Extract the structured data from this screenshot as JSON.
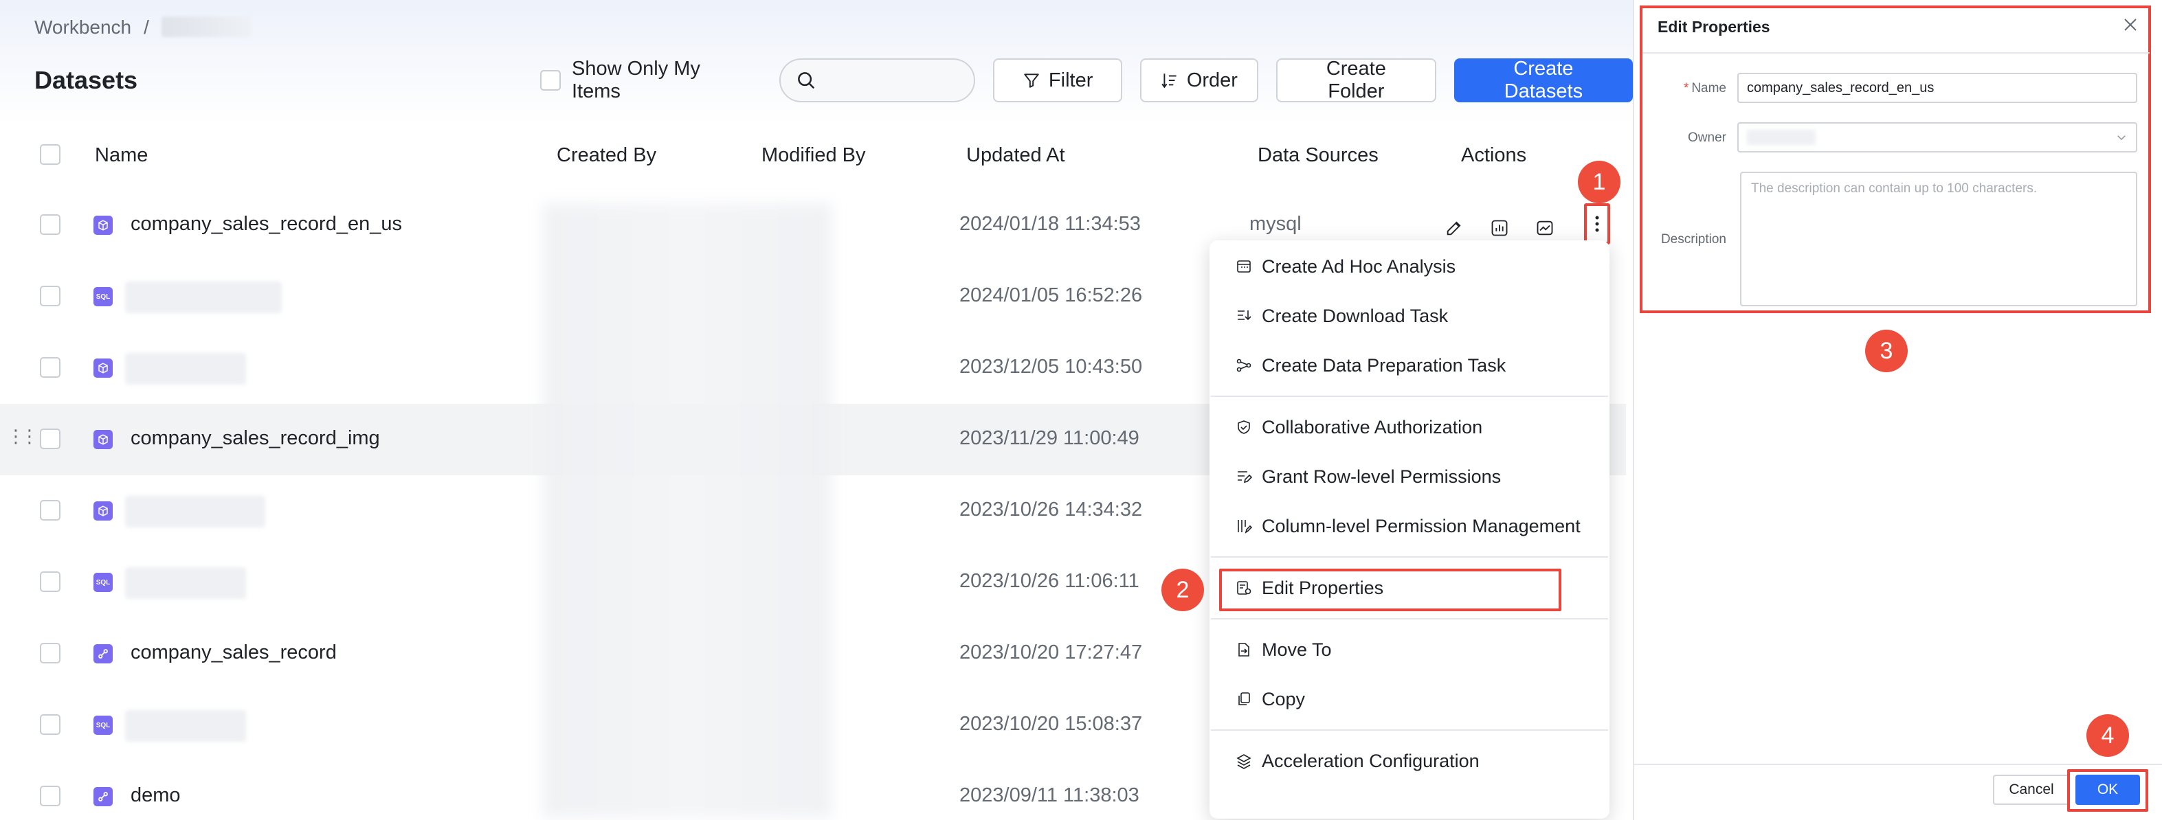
{
  "breadcrumb": {
    "root": "Workbench",
    "separator": "/",
    "current": ""
  },
  "page_title": "Datasets",
  "toolbar": {
    "show_only_mine": "Show Only My Items",
    "search_placeholder": "",
    "filter": "Filter",
    "order": "Order",
    "create_folder": "Create Folder",
    "create_datasets": "Create Datasets"
  },
  "table": {
    "columns": [
      "Name",
      "Created By",
      "Modified By",
      "Updated At",
      "Data Sources",
      "Actions"
    ],
    "rows": [
      {
        "icon": "cube-icon",
        "name": "company_sales_record_en_us",
        "updated": "2024/01/18 11:34:53",
        "source": "mysql"
      },
      {
        "icon": "sql-icon",
        "name": "",
        "updated": "2024/01/05 16:52:26",
        "source": ""
      },
      {
        "icon": "cube-icon",
        "name": "",
        "updated": "2023/12/05 10:43:50",
        "source": ""
      },
      {
        "icon": "cube-icon",
        "name": "company_sales_record_img",
        "updated": "2023/11/29 11:00:49",
        "source": ""
      },
      {
        "icon": "cube-icon",
        "name": "",
        "updated": "2023/10/26 14:34:32",
        "source": ""
      },
      {
        "icon": "sql-icon",
        "name": "",
        "updated": "2023/10/26 11:06:11",
        "source": ""
      },
      {
        "icon": "link-icon",
        "name": "company_sales_record",
        "updated": "2023/10/20 17:27:47",
        "source": ""
      },
      {
        "icon": "sql-icon",
        "name": "",
        "updated": "2023/10/20 15:08:37",
        "source": ""
      },
      {
        "icon": "link-icon",
        "name": "demo",
        "updated": "2023/09/11 11:38:03",
        "source": ""
      }
    ],
    "sql_badge": "SQL"
  },
  "menu": {
    "items": [
      "Create Ad Hoc Analysis",
      "Create Download Task",
      "Create Data Preparation Task",
      "Collaborative Authorization",
      "Grant Row-level Permissions",
      "Column-level Permission Management",
      "Edit Properties",
      "Move To",
      "Copy",
      "Acceleration Configuration"
    ]
  },
  "steps": [
    "1",
    "2",
    "3",
    "4"
  ],
  "panel": {
    "title": "Edit Properties",
    "name_label": "Name",
    "name_value": "company_sales_record_en_us",
    "owner_label": "Owner",
    "description_label": "Description",
    "description_placeholder": "The description can contain up to 100 characters.",
    "cancel": "Cancel",
    "ok": "OK"
  },
  "colors": {
    "primary": "#2b6ef5",
    "highlight": "#e8453c",
    "type_icon": "#7a6bf0"
  }
}
